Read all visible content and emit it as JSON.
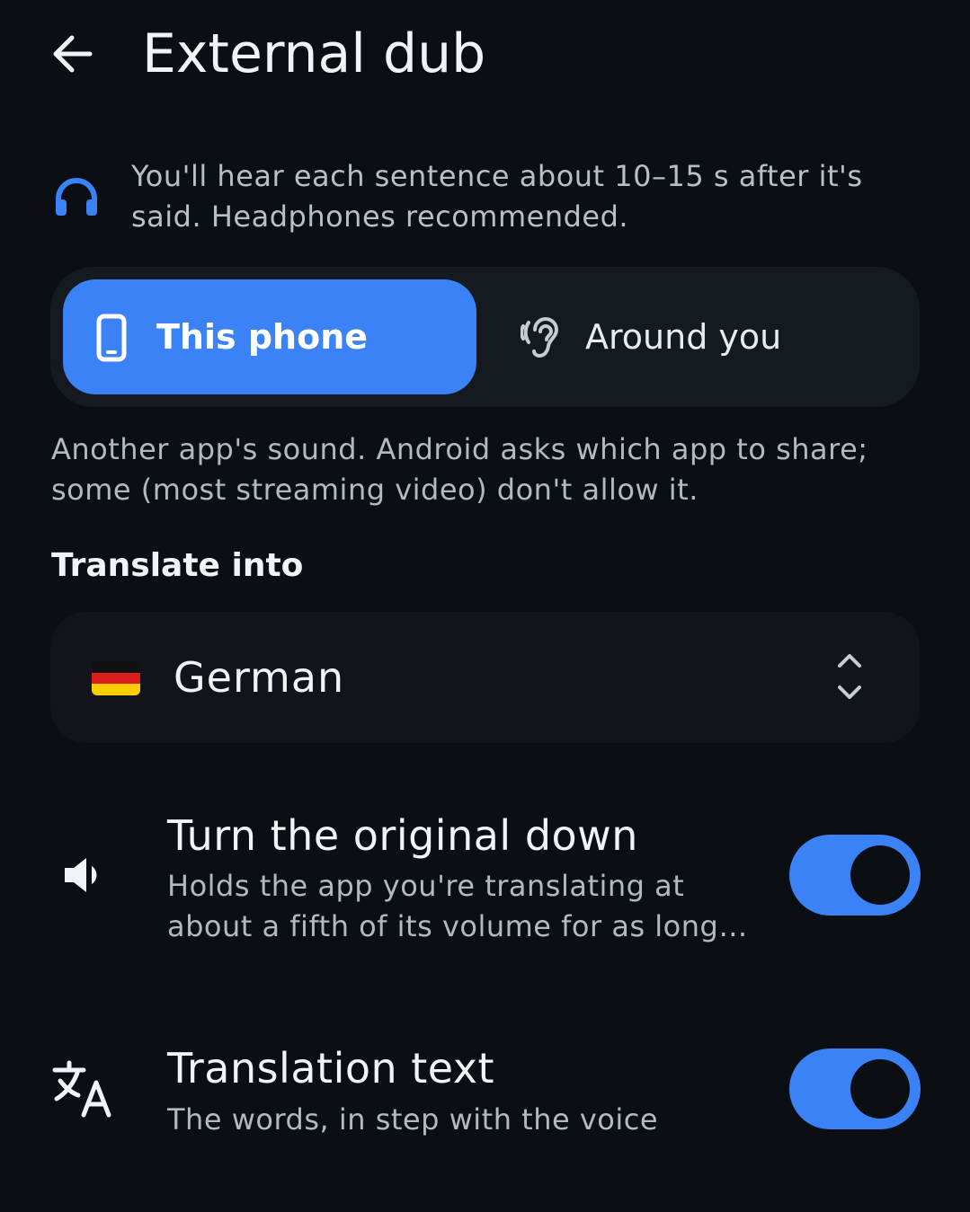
{
  "header": {
    "title": "External dub",
    "back_icon": "arrow-left-icon"
  },
  "info": {
    "icon": "headphones-icon",
    "text": "You'll hear each sentence about 10–15 s after it's said. Headphones recommended."
  },
  "source": {
    "options": [
      {
        "label": "This phone",
        "icon": "phone-icon",
        "selected": true
      },
      {
        "label": "Around you",
        "icon": "ear-icon",
        "selected": false
      }
    ],
    "description": "Another app's sound. Android asks which app to share; some (most streaming video) don't allow it."
  },
  "translate": {
    "label": "Translate into",
    "language": "German",
    "flag": "german-flag-icon",
    "selector_icon": "unfold-icon"
  },
  "settings": [
    {
      "title": "Turn the original down",
      "subtitle": "Holds the app you're translating at about a fifth of its volume for as long…",
      "icon": "volume-down-icon",
      "enabled": true
    },
    {
      "title": "Translation text",
      "subtitle": "The words, in step with the voice",
      "icon": "translate-icon",
      "enabled": true
    }
  ],
  "colors": {
    "background": "#0b0f14",
    "accent": "#3b82f6",
    "surface": "#151a21"
  }
}
